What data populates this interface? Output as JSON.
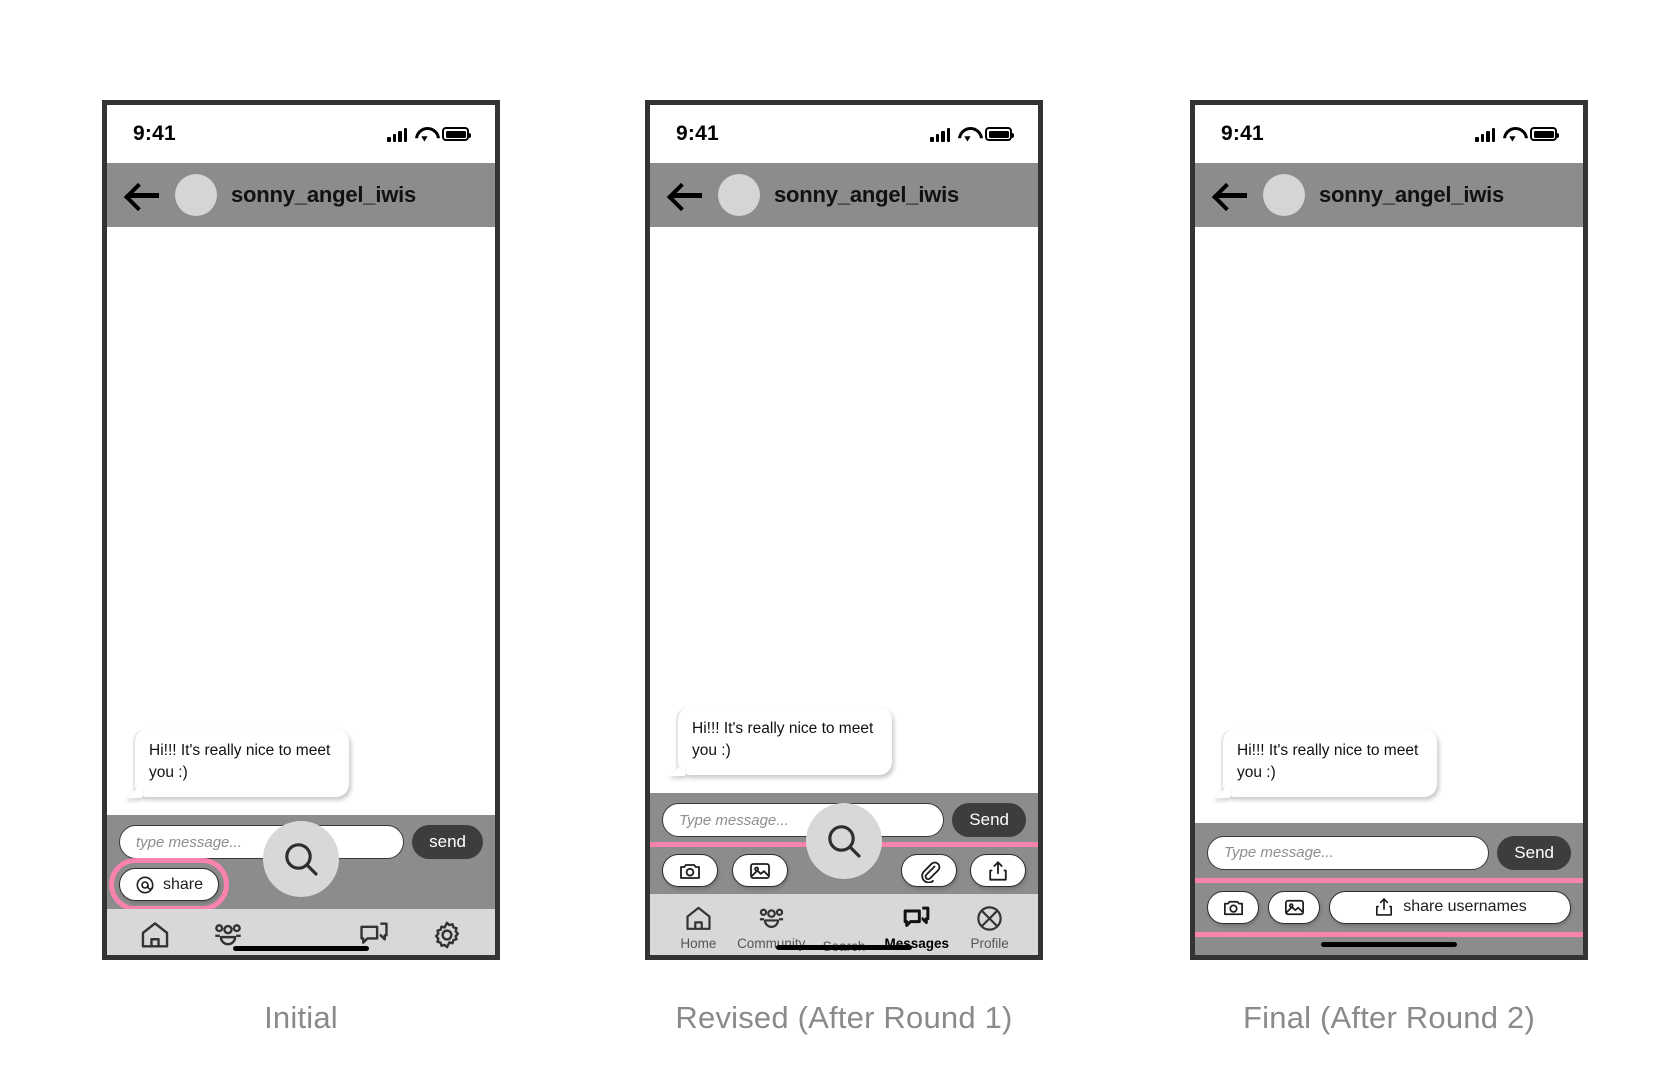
{
  "status_bar": {
    "time": "9:41",
    "signal_icon": "cellular-signal-icon",
    "wifi_icon": "wifi-icon",
    "battery_icon": "battery-icon"
  },
  "chat_header": {
    "back_icon": "back-arrow-icon",
    "avatar": "avatar",
    "title": "sonny_angel_iwis"
  },
  "message": {
    "text": "Hi!!! It's really nice to meet you :)"
  },
  "screens": [
    {
      "id": "initial",
      "caption": "Initial",
      "composer": {
        "placeholder": "type message...",
        "send_label": "send"
      },
      "actions": [
        {
          "icon": "at-mention-icon",
          "label": "share"
        }
      ],
      "nav": {
        "fab": {
          "icon": "search-icon",
          "label": ""
        },
        "items": [
          {
            "icon": "home-icon",
            "label": ""
          },
          {
            "icon": "community-icon",
            "label": ""
          },
          {
            "icon": "search-icon",
            "label": ""
          },
          {
            "icon": "messages-icon",
            "label": ""
          },
          {
            "icon": "settings-gear-icon",
            "label": ""
          }
        ]
      }
    },
    {
      "id": "revised",
      "caption": "Revised (After Round 1)",
      "composer": {
        "placeholder": "Type message...",
        "send_label": "Send"
      },
      "actions": [
        {
          "icon": "camera-icon",
          "label": ""
        },
        {
          "icon": "photo-image-icon",
          "label": ""
        },
        {
          "icon": "paperclip-icon",
          "label": ""
        },
        {
          "icon": "share-upload-icon",
          "label": ""
        }
      ],
      "nav": {
        "fab": {
          "icon": "search-icon",
          "label": "Search"
        },
        "items": [
          {
            "icon": "home-icon",
            "label": "Home"
          },
          {
            "icon": "community-icon",
            "label": "Community"
          },
          {
            "icon": "search-icon",
            "label": "Search"
          },
          {
            "icon": "messages-icon",
            "label": "Messages"
          },
          {
            "icon": "profile-icon",
            "label": "Profile"
          }
        ],
        "active_label": "Messages"
      }
    },
    {
      "id": "final",
      "caption": "Final (After Round 2)",
      "composer": {
        "placeholder": "Type message...",
        "send_label": "Send"
      },
      "actions": [
        {
          "icon": "camera-icon",
          "label": ""
        },
        {
          "icon": "photo-image-icon",
          "label": ""
        },
        {
          "icon": "share-upload-icon",
          "label": "share usernames"
        }
      ],
      "nav": null
    }
  ],
  "colors": {
    "highlight_pink": "#f982ae",
    "header_gray": "#8c8c8c",
    "nav_gray": "#d8d8d8",
    "frame_dark": "#333333",
    "send_button": "#3d3d3d",
    "caption_text": "#8a8a8a"
  }
}
